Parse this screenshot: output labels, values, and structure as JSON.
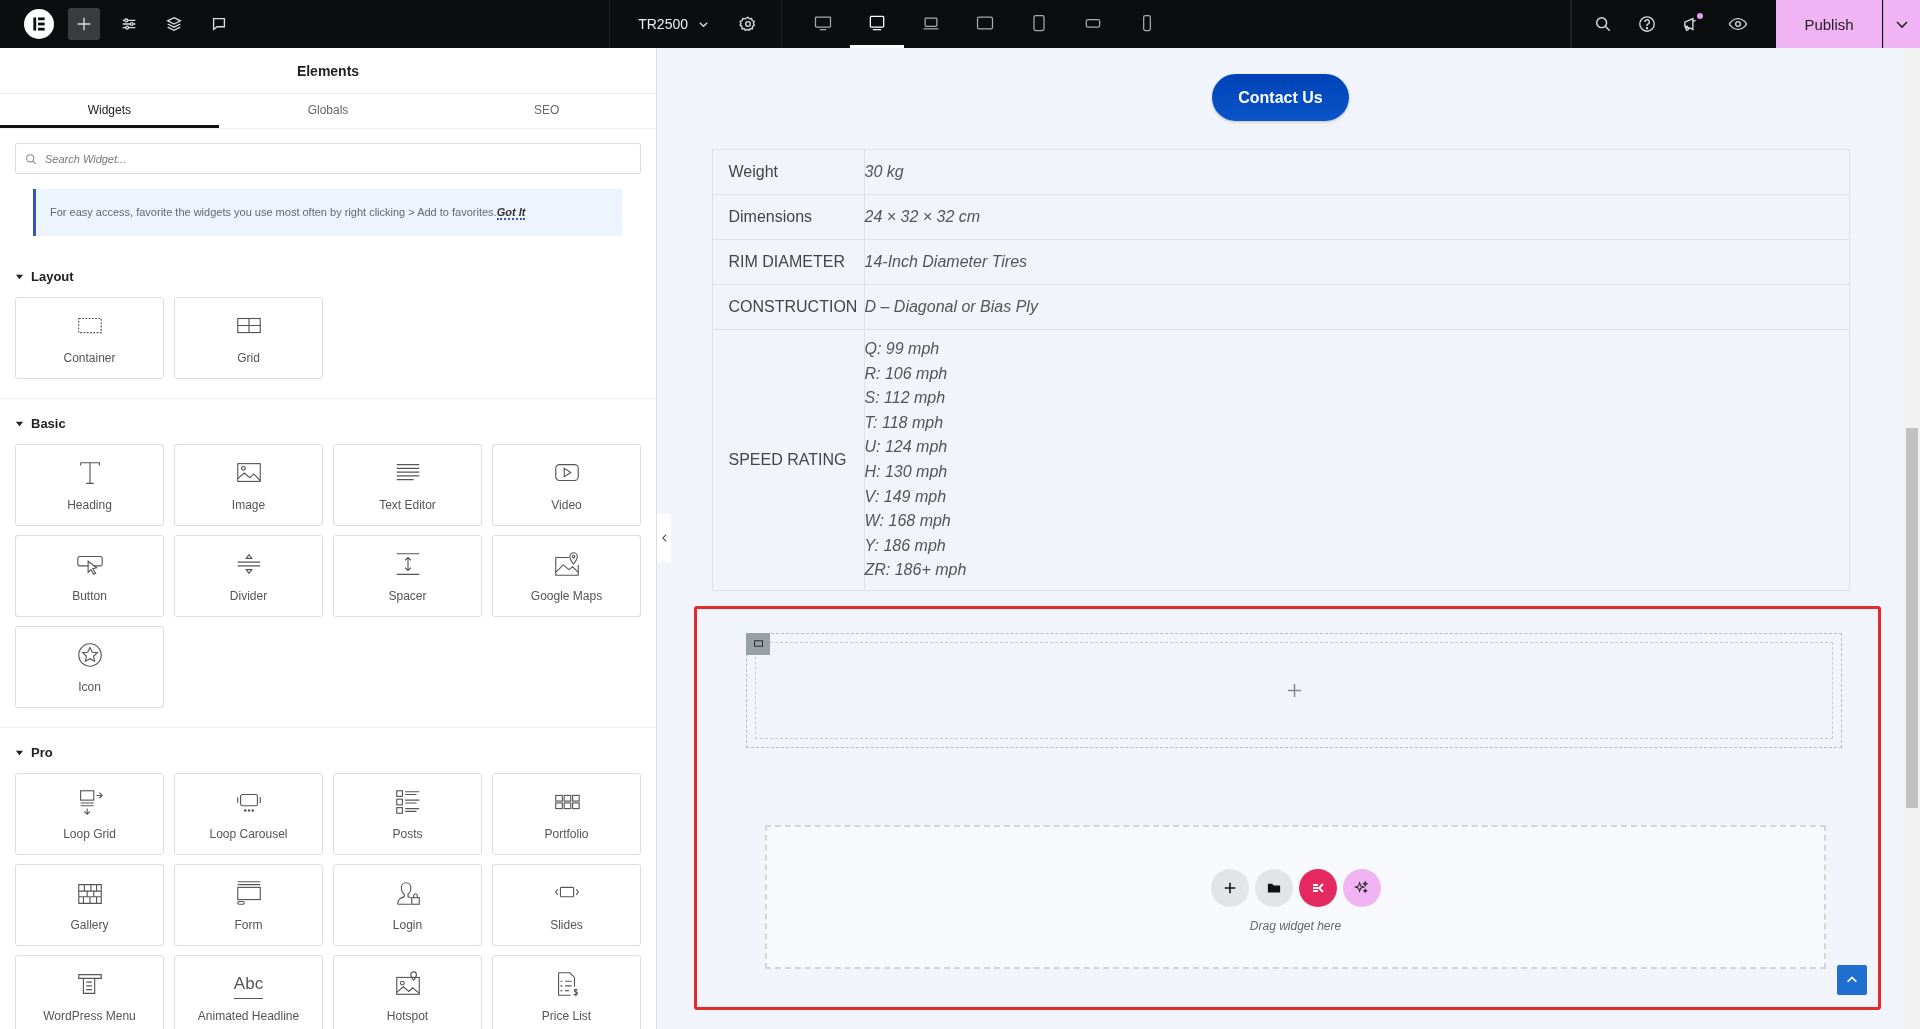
{
  "topbar": {
    "tools": [
      {
        "kind": "add",
        "selected": true
      },
      {
        "kind": "settings",
        "selected": false
      },
      {
        "kind": "layers",
        "selected": false
      },
      {
        "kind": "comments",
        "selected": false
      }
    ],
    "site_name": "TR2500",
    "devices": [
      {
        "kind": "desktop",
        "selected": false
      },
      {
        "kind": "monitor",
        "selected": true
      },
      {
        "kind": "laptop",
        "selected": false
      },
      {
        "kind": "tablet-landscape",
        "selected": false
      },
      {
        "kind": "tablet",
        "selected": false
      },
      {
        "kind": "mobile-landscape",
        "selected": false
      },
      {
        "kind": "mobile",
        "selected": false
      }
    ],
    "notifications": true,
    "publish": "Publish"
  },
  "panel": {
    "title": "Elements",
    "tabs": [
      {
        "label": "Widgets",
        "selected": true
      },
      {
        "label": "Globals",
        "selected": false
      },
      {
        "label": "SEO",
        "selected": false
      }
    ],
    "search": {
      "placeholder": "Search Widget..."
    },
    "notice": {
      "text": "For easy access, favorite the widgets you use most often by right clicking > Add to favorites.",
      "link": "Got It"
    },
    "categories": [
      {
        "title": "Layout",
        "expanded": true,
        "widgets": [
          {
            "label": "Container",
            "kind": "container"
          },
          {
            "label": "Grid",
            "kind": "grid"
          }
        ]
      },
      {
        "title": "Basic",
        "expanded": true,
        "widgets": [
          {
            "label": "Heading",
            "kind": "heading"
          },
          {
            "label": "Image",
            "kind": "image"
          },
          {
            "label": "Text Editor",
            "kind": "text-editor"
          },
          {
            "label": "Video",
            "kind": "video"
          },
          {
            "label": "Button",
            "kind": "button"
          },
          {
            "label": "Divider",
            "kind": "divider"
          },
          {
            "label": "Spacer",
            "kind": "spacer"
          },
          {
            "label": "Google Maps",
            "kind": "maps"
          },
          {
            "label": "Icon",
            "kind": "icon"
          }
        ]
      },
      {
        "title": "Pro",
        "expanded": true,
        "widgets": [
          {
            "label": "Loop Grid",
            "kind": "loop-grid"
          },
          {
            "label": "Loop Carousel",
            "kind": "loop-carousel"
          },
          {
            "label": "Posts",
            "kind": "posts"
          },
          {
            "label": "Portfolio",
            "kind": "portfolio"
          },
          {
            "label": "Gallery",
            "kind": "gallery"
          },
          {
            "label": "Form",
            "kind": "form"
          },
          {
            "label": "Login",
            "kind": "login"
          },
          {
            "label": "Slides",
            "kind": "slides"
          },
          {
            "label": "WordPress Menu",
            "kind": "menu"
          },
          {
            "label": "Animated Headline",
            "kind": "headline",
            "glyph": "Abc"
          },
          {
            "label": "Hotspot",
            "kind": "hotspot"
          },
          {
            "label": "Price List",
            "kind": "price-list"
          }
        ]
      }
    ]
  },
  "canvas": {
    "contact_button": "Contact Us",
    "specs": [
      {
        "label": "Weight",
        "values": [
          "30 kg"
        ]
      },
      {
        "label": "Dimensions",
        "values": [
          "24 × 32 × 32 cm"
        ]
      },
      {
        "label": "RIM DIAMETER",
        "values": [
          "14-Inch Diameter Tires"
        ]
      },
      {
        "label": "CONSTRUCTION",
        "values": [
          "D – Diagonal or Bias Ply"
        ]
      },
      {
        "label": "SPEED RATING",
        "values": [
          "Q: 99 mph",
          "R: 106 mph",
          "S: 112 mph",
          "T: 118 mph",
          "U: 124 mph",
          "H: 130 mph",
          "V: 149 mph",
          "W: 168 mph",
          "Y: 186 mph",
          "ZR: 186+ mph"
        ]
      }
    ],
    "drop_zone": {
      "hint": "Drag widget here"
    }
  }
}
